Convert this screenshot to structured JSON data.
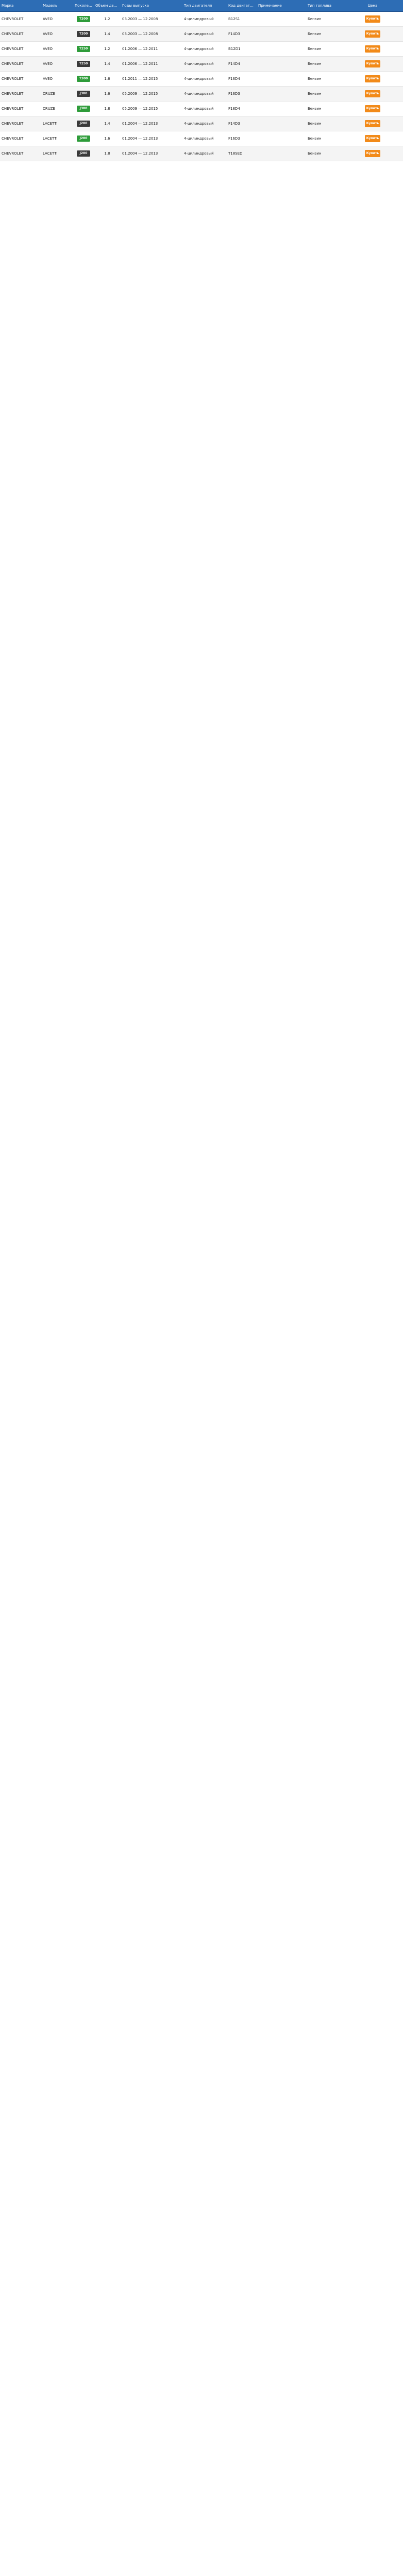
{
  "header": {
    "brand": "Марка",
    "model": "Модель",
    "gen": "Поколение",
    "vol": "Объем двигателя",
    "years": "Годы выпуска",
    "engine": "Тип двигателя",
    "code": "Код двигателя",
    "notes": "Примечание",
    "fuel": "Тип топлива",
    "price": "Цена"
  },
  "buy_label": "Купить",
  "rows": [
    {
      "brand": "CHEVROLET",
      "model": "AVEO",
      "gen": "T200",
      "vol": "1.2",
      "years": "03.2003 — 12.2008",
      "engine": "4-цилиндровый",
      "code": "B12S1",
      "notes": "",
      "fuel": "Бензин"
    },
    {
      "brand": "CHEVROLET",
      "model": "AVEO",
      "gen": "T200",
      "vol": "1.4",
      "years": "03.2003 — 12.2008",
      "engine": "4-цилиндровый",
      "code": "F14D3",
      "notes": "",
      "fuel": "Бензин"
    },
    {
      "brand": "CHEVROLET",
      "model": "AVEO",
      "gen": "T250",
      "vol": "1.2",
      "years": "01.2006 — 12.2011",
      "engine": "4-цилиндровый",
      "code": "B12D1",
      "notes": "",
      "fuel": "Бензин"
    },
    {
      "brand": "CHEVROLET",
      "model": "AVEO",
      "gen": "T250",
      "vol": "1.4",
      "years": "01.2006 — 12.2011",
      "engine": "4-цилиндровый",
      "code": "F14D4",
      "notes": "",
      "fuel": "Бензин"
    },
    {
      "brand": "CHEVROLET",
      "model": "AVEO",
      "gen": "T300",
      "vol": "1.6",
      "years": "01.2011 — 12.2015",
      "engine": "4-цилиндровый",
      "code": "F16D4",
      "notes": "",
      "fuel": "Бензин"
    },
    {
      "brand": "CHEVROLET",
      "model": "CRUZE",
      "gen": "J300",
      "vol": "1.6",
      "years": "05.2009 — 12.2015",
      "engine": "4-цилиндровый",
      "code": "F16D3",
      "notes": "",
      "fuel": "Бензин"
    },
    {
      "brand": "CHEVROLET",
      "model": "CRUZE",
      "gen": "J300",
      "vol": "1.8",
      "years": "05.2009 — 12.2015",
      "engine": "4-цилиндровый",
      "code": "F18D4",
      "notes": "",
      "fuel": "Бензин"
    },
    {
      "brand": "CHEVROLET",
      "model": "LACETTI",
      "gen": "J200",
      "vol": "1.4",
      "years": "01.2004 — 12.2013",
      "engine": "4-цилиндровый",
      "code": "F14D3",
      "notes": "",
      "fuel": "Бензин"
    },
    {
      "brand": "CHEVROLET",
      "model": "LACETTI",
      "gen": "J200",
      "vol": "1.6",
      "years": "01.2004 — 12.2013",
      "engine": "4-цилиндровый",
      "code": "F16D3",
      "notes": "",
      "fuel": "Бензин"
    },
    {
      "brand": "CHEVROLET",
      "model": "LACETTI",
      "gen": "J200",
      "vol": "1.8",
      "years": "01.2004 — 12.2013",
      "engine": "4-цилиндровый",
      "code": "T18SED",
      "notes": "",
      "fuel": "Бензин"
    }
  ]
}
